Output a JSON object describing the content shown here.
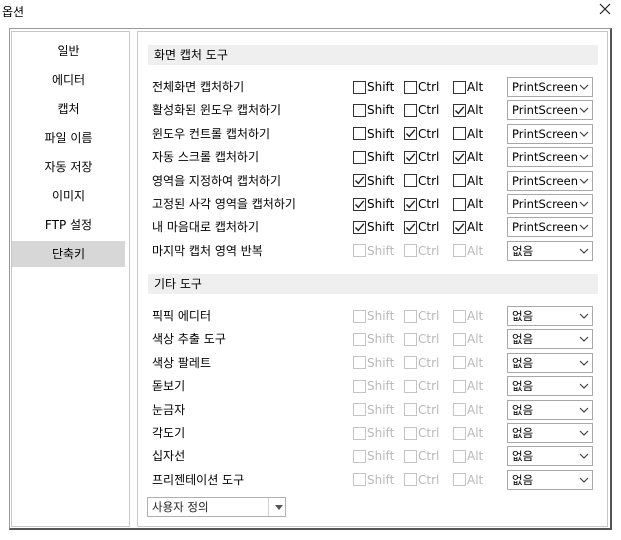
{
  "window": {
    "title": "옵션"
  },
  "sidebar": {
    "items": [
      {
        "label": "일반"
      },
      {
        "label": "에디터"
      },
      {
        "label": "캡처"
      },
      {
        "label": "파일 이름"
      },
      {
        "label": "자동 저장"
      },
      {
        "label": "이미지"
      },
      {
        "label": "FTP 설정"
      },
      {
        "label": "단축키",
        "selected": true
      }
    ]
  },
  "modifiers": {
    "shift": "Shift",
    "ctrl": "Ctrl",
    "alt": "Alt"
  },
  "sections": [
    {
      "title": "화면 캡처 도구",
      "rows": [
        {
          "label": "전체화면 캡처하기",
          "shift": false,
          "ctrl": false,
          "alt": false,
          "enabled": true,
          "key": "PrintScreen"
        },
        {
          "label": "활성화된 윈도우 캡처하기",
          "shift": false,
          "ctrl": false,
          "alt": true,
          "enabled": true,
          "key": "PrintScreen"
        },
        {
          "label": "윈도우 컨트롤 캡처하기",
          "shift": false,
          "ctrl": true,
          "alt": false,
          "enabled": true,
          "key": "PrintScreen"
        },
        {
          "label": "자동 스크롤 캡처하기",
          "shift": false,
          "ctrl": true,
          "alt": true,
          "enabled": true,
          "key": "PrintScreen"
        },
        {
          "label": "영역을 지정하여 캡처하기",
          "shift": true,
          "ctrl": false,
          "alt": false,
          "enabled": true,
          "key": "PrintScreen"
        },
        {
          "label": "고정된 사각 영역을 캡처하기",
          "shift": true,
          "ctrl": true,
          "alt": false,
          "enabled": true,
          "key": "PrintScreen"
        },
        {
          "label": "내 마음대로 캡처하기",
          "shift": true,
          "ctrl": true,
          "alt": true,
          "enabled": true,
          "key": "PrintScreen"
        },
        {
          "label": "마지막 캡처 영역 반복",
          "shift": false,
          "ctrl": false,
          "alt": false,
          "enabled": false,
          "key": "없음"
        }
      ]
    },
    {
      "title": "기타 도구",
      "rows": [
        {
          "label": "픽픽 에디터",
          "shift": false,
          "ctrl": false,
          "alt": false,
          "enabled": false,
          "key": "없음"
        },
        {
          "label": "색상 추출 도구",
          "shift": false,
          "ctrl": false,
          "alt": false,
          "enabled": false,
          "key": "없음"
        },
        {
          "label": "색상 팔레트",
          "shift": false,
          "ctrl": false,
          "alt": false,
          "enabled": false,
          "key": "없음"
        },
        {
          "label": "돋보기",
          "shift": false,
          "ctrl": false,
          "alt": false,
          "enabled": false,
          "key": "없음"
        },
        {
          "label": "눈금자",
          "shift": false,
          "ctrl": false,
          "alt": false,
          "enabled": false,
          "key": "없음"
        },
        {
          "label": "각도기",
          "shift": false,
          "ctrl": false,
          "alt": false,
          "enabled": false,
          "key": "없음"
        },
        {
          "label": "십자선",
          "shift": false,
          "ctrl": false,
          "alt": false,
          "enabled": false,
          "key": "없음"
        },
        {
          "label": "프리젠테이션 도구",
          "shift": false,
          "ctrl": false,
          "alt": false,
          "enabled": false,
          "key": "없음"
        }
      ]
    }
  ],
  "preset": {
    "value": "사용자 정의"
  },
  "icons": {
    "close": "close-icon",
    "dropdown": "chevron-down-icon",
    "check": "check-icon"
  }
}
